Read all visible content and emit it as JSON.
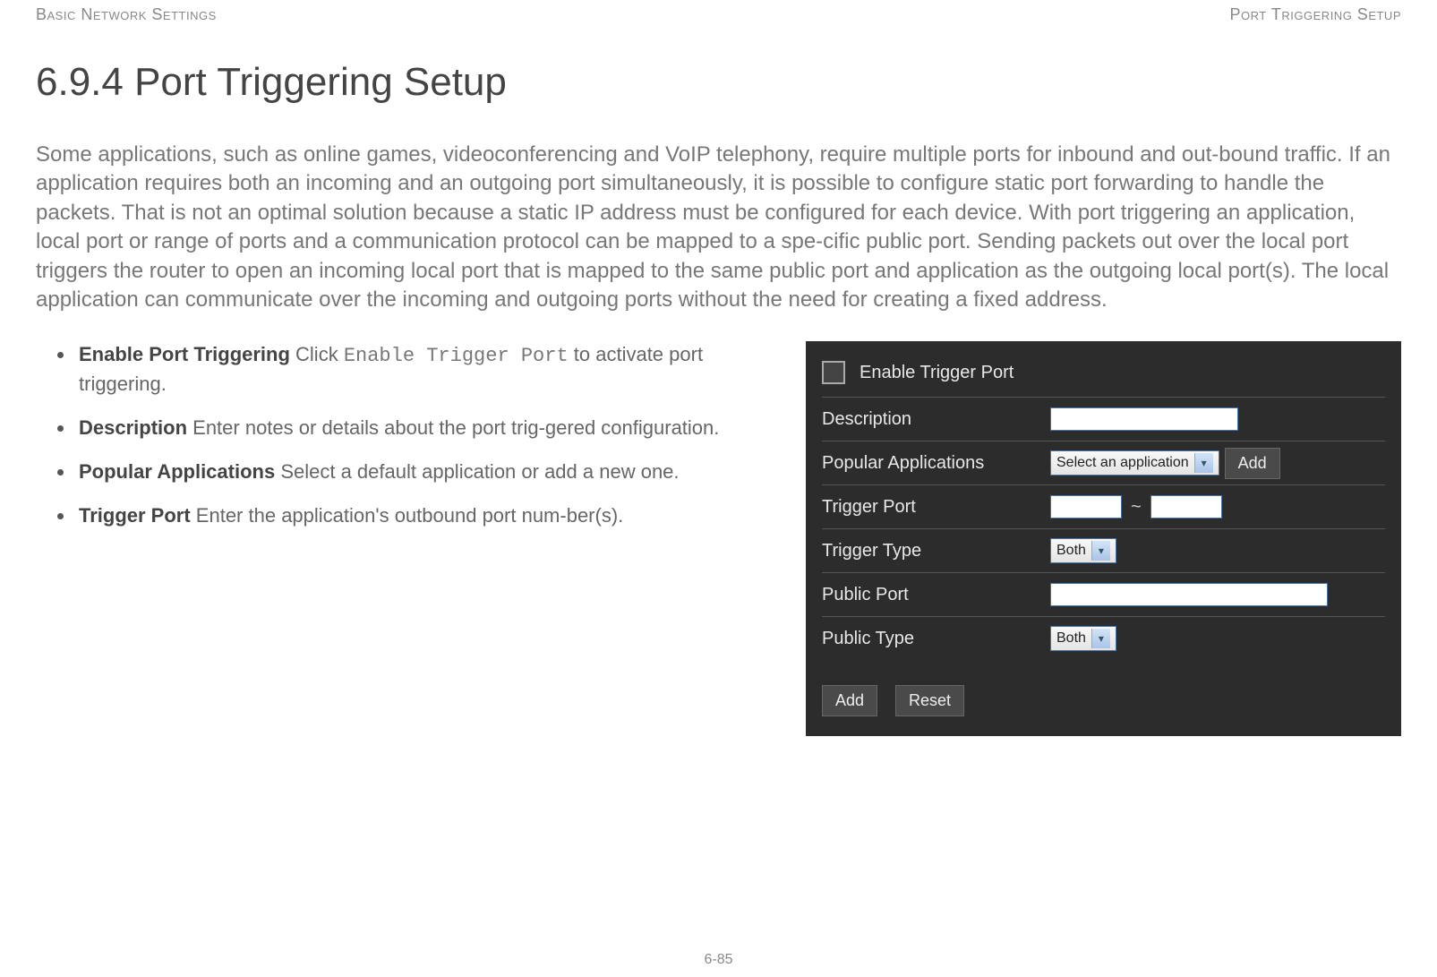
{
  "header": {
    "left": "Basic Network Settings",
    "right": "Port Triggering Setup"
  },
  "heading": "6.9.4 Port Triggering Setup",
  "intro": "Some applications, such as online games, videoconferencing and VoIP telephony, require multiple ports for inbound and out-bound traffic. If an application requires both an incoming and an outgoing port simultaneously, it is possible to configure static port forwarding to handle the packets. That is not an optimal solution because a static IP address must be configured for each device. With port triggering an application, local port or range of ports and a communication protocol can be mapped to a spe-cific public port. Sending packets out over the local port triggers the router to open an incoming local port that is mapped to the same public port and application as the outgoing local port(s). The local application can communicate over the incoming and outgoing ports without the need for creating a fixed address.",
  "bullets": [
    {
      "term": "Enable Port Triggering",
      "pre": "  Click ",
      "code": "Enable Trigger Port",
      "post": " to activate port triggering."
    },
    {
      "term": "Description",
      "pre": "  Enter notes or details about the port trig-gered configuration.",
      "code": "",
      "post": ""
    },
    {
      "term": "Popular Applications",
      "pre": "  Select a default application or add a new one.",
      "code": "",
      "post": ""
    },
    {
      "term": "Trigger Port",
      "pre": "  Enter the application's outbound port num-ber(s).",
      "code": "",
      "post": ""
    }
  ],
  "panel": {
    "enable_label": "Enable Trigger Port",
    "rows": {
      "description": "Description",
      "popular_apps": "Popular Applications",
      "trigger_port": "Trigger Port",
      "trigger_type": "Trigger Type",
      "public_port": "Public Port",
      "public_type": "Public Type"
    },
    "select_app": "Select an application",
    "both": "Both",
    "tilde": "~",
    "add_btn": "Add",
    "reset_btn": "Reset"
  },
  "footer": "6-85"
}
